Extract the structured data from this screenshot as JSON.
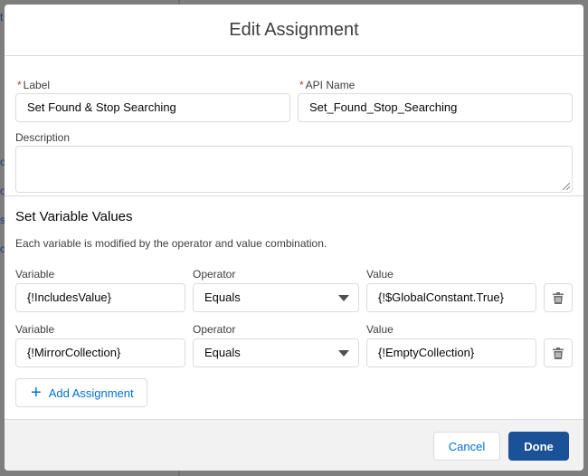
{
  "modal": {
    "title": "Edit Assignment"
  },
  "fields": {
    "label": {
      "label": "Label",
      "required_marker": "*",
      "value": "Set Found & Stop Searching"
    },
    "api_name": {
      "label": "API Name",
      "required_marker": "*",
      "value": "Set_Found_Stop_Searching"
    },
    "description": {
      "label": "Description",
      "value": ""
    }
  },
  "set_variables": {
    "title": "Set Variable Values",
    "helper": "Each variable is modified by the operator and value combination.",
    "column_labels": {
      "variable": "Variable",
      "operator": "Operator",
      "value": "Value"
    },
    "rows": [
      {
        "variable": "{!IncludesValue}",
        "operator": "Equals",
        "value": "{!$GlobalConstant.True}"
      },
      {
        "variable": "{!MirrorCollection}",
        "operator": "Equals",
        "value": "{!EmptyCollection}"
      }
    ],
    "add_label": "Add Assignment"
  },
  "footer": {
    "cancel_label": "Cancel",
    "done_label": "Done"
  },
  "background": {
    "fragments": [
      "t",
      "o",
      "o",
      "s",
      "o"
    ]
  },
  "colors": {
    "brand_button": "#1b5297",
    "link": "#0070d2",
    "required": "#c23934"
  },
  "icons": {
    "delete": "trash-icon",
    "add": "plus-icon",
    "dropdown": "chevron-down-icon"
  }
}
